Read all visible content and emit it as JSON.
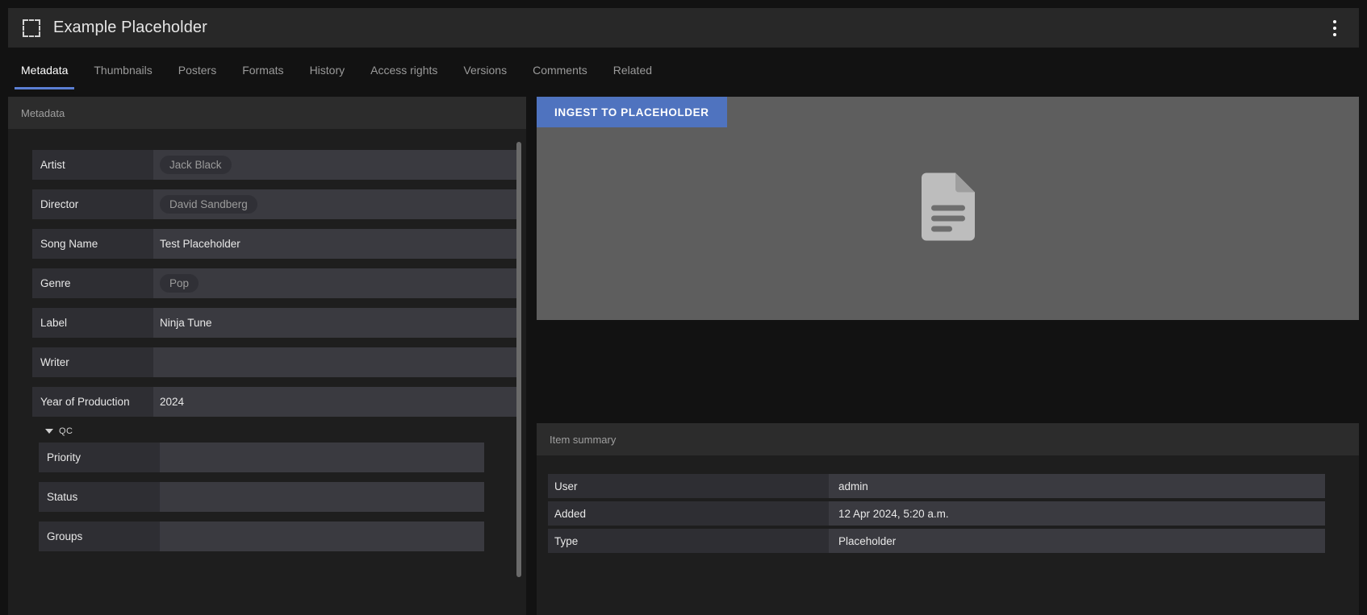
{
  "header": {
    "title": "Example Placeholder",
    "icon": "placeholder-frame-icon",
    "menu_icon": "kebab-menu-icon"
  },
  "tabs": [
    {
      "label": "Metadata",
      "active": true
    },
    {
      "label": "Thumbnails",
      "active": false
    },
    {
      "label": "Posters",
      "active": false
    },
    {
      "label": "Formats",
      "active": false
    },
    {
      "label": "History",
      "active": false
    },
    {
      "label": "Access rights",
      "active": false
    },
    {
      "label": "Versions",
      "active": false
    },
    {
      "label": "Comments",
      "active": false
    },
    {
      "label": "Related",
      "active": false
    }
  ],
  "metadata_panel": {
    "title": "Metadata",
    "fields": [
      {
        "label": "Artist",
        "value": "Jack Black",
        "style": "chip"
      },
      {
        "label": "Director",
        "value": "David Sandberg",
        "style": "chip"
      },
      {
        "label": "Song Name",
        "value": "Test Placeholder",
        "style": "text"
      },
      {
        "label": "Genre",
        "value": "Pop",
        "style": "chip"
      },
      {
        "label": "Label",
        "value": "Ninja Tune",
        "style": "text"
      },
      {
        "label": "Writer",
        "value": "",
        "style": "text"
      },
      {
        "label": "Year of Production",
        "value": "2024",
        "style": "text"
      }
    ],
    "qc_section": {
      "title": "QC",
      "expanded": true,
      "fields": [
        {
          "label": "Priority",
          "value": ""
        },
        {
          "label": "Status",
          "value": ""
        },
        {
          "label": "Groups",
          "value": ""
        }
      ]
    }
  },
  "preview_panel": {
    "ingest_button": "INGEST TO PLACEHOLDER",
    "placeholder_icon": "document-icon"
  },
  "item_summary": {
    "title": "Item summary",
    "rows": [
      {
        "label": "User",
        "value": "admin"
      },
      {
        "label": "Added",
        "value": "12 Apr 2024, 5:20 a.m."
      },
      {
        "label": "Type",
        "value": "Placeholder"
      }
    ]
  },
  "colors": {
    "page_background": "#121212",
    "panel_background": "#1e1e1e",
    "header_background": "#282828",
    "field_label_background": "#2e2e33",
    "field_value_background": "#3a3a40",
    "accent_blue": "#5b7fd4",
    "button_blue": "#4f73bf",
    "preview_grey": "#5e5e5e"
  }
}
